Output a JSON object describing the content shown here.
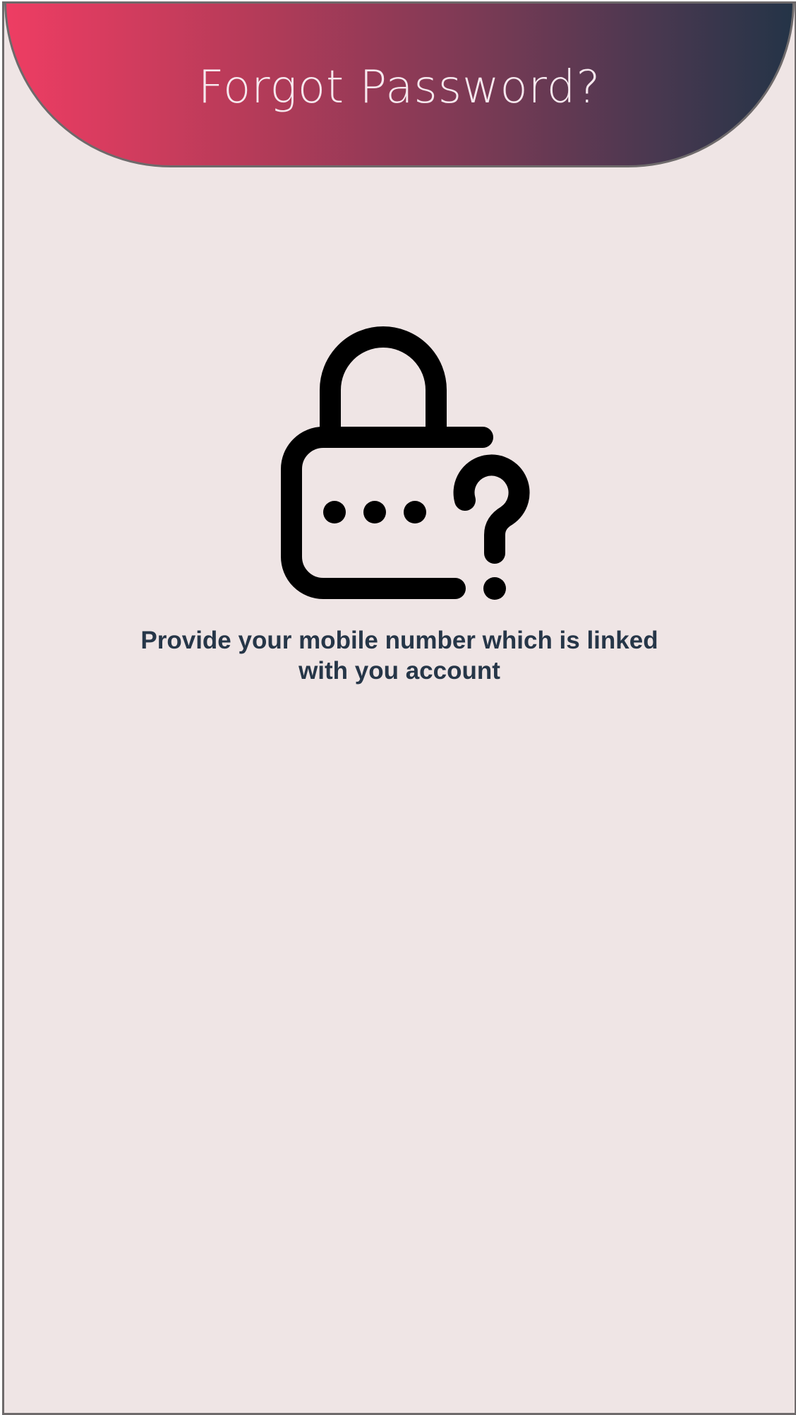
{
  "header": {
    "title": "Forgot Password?"
  },
  "illustration": {
    "icon": "lock-question-icon",
    "color": "#000000"
  },
  "prompt": {
    "text": "Provide your mobile number which is linked with you account"
  },
  "colors": {
    "background": "#efe5e5",
    "gradient_start": "#ee3d63",
    "gradient_end": "#243447",
    "text_dark": "#263648"
  }
}
